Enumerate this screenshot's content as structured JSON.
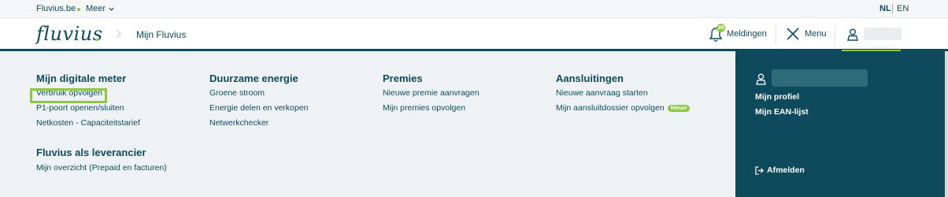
{
  "topbar": {
    "site_link": "Fluvius.be",
    "more_label": "Meer",
    "lang_nl": "NL",
    "lang_en": "EN"
  },
  "header": {
    "logo_text": "fluvius",
    "breadcrumb": "Mijn Fluvius",
    "notifications_label": "Meldingen",
    "notifications_count": "39",
    "menu_label": "Menu"
  },
  "mega_menu": {
    "columns": [
      {
        "title": "Mijn digitale meter",
        "items": [
          "Verbruik opvolgen",
          "P1-poort openen/sluiten",
          "Netkosten - Capaciteitstarief"
        ]
      },
      {
        "title": "Duurzame energie",
        "items": [
          "Groene stroom",
          "Energie delen en verkopen",
          "Netwerkchecker"
        ]
      },
      {
        "title": "Premies",
        "items": [
          "Nieuwe premie aanvragen",
          "Mijn premies opvolgen"
        ]
      },
      {
        "title": "Aansluitingen",
        "items": [
          "Nieuwe aanvraag starten",
          "Mijn aansluitdossier opvolgen"
        ],
        "badge": "Nieuw"
      }
    ],
    "supplier": {
      "title": "Fluvius als leverancier",
      "items": [
        "Mijn overzicht (Prepaid en facturen)"
      ]
    }
  },
  "account_panel": {
    "links": [
      "Mijn profiel",
      "Mijn EAN-lijst"
    ],
    "logout_label": "Afmelden"
  },
  "colors": {
    "brand_dark": "#0d4b5c",
    "accent_green": "#8dc63f",
    "menu_bg": "#eef2f4"
  }
}
